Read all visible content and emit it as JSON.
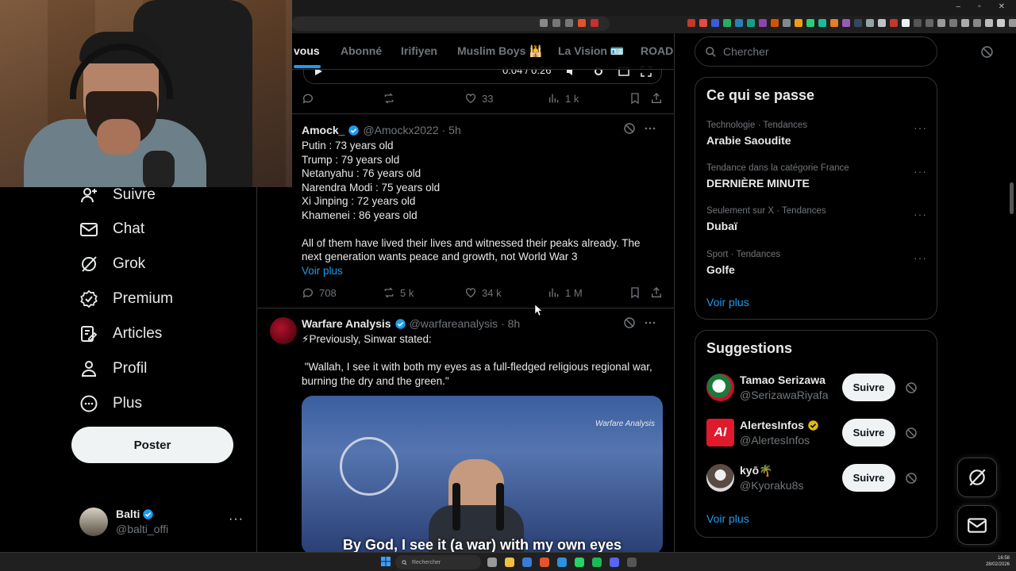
{
  "window": {
    "minimize": "–",
    "maximize": "▫",
    "close": "✕"
  },
  "nav": {
    "items": [
      {
        "label": "Suivre",
        "icon": "follow-icon"
      },
      {
        "label": "Chat",
        "icon": "mail-icon"
      },
      {
        "label": "Grok",
        "icon": "grok-icon"
      },
      {
        "label": "Premium",
        "icon": "premium-icon"
      },
      {
        "label": "Articles",
        "icon": "articles-icon"
      },
      {
        "label": "Profil",
        "icon": "profile-icon"
      },
      {
        "label": "Plus",
        "icon": "more-icon"
      }
    ],
    "post_button": "Poster",
    "profile": {
      "name": "Balti",
      "handle": "@balti_offi",
      "more": "···"
    }
  },
  "tabs": [
    "vous",
    "Abonné",
    "Irifiyen",
    "Muslim Boys 🕌",
    "La Vision 🪪",
    "ROAD"
  ],
  "video_time": "0:04 / 0:26",
  "tweets": [
    {
      "id": "top",
      "stats": {
        "replies": "",
        "reposts": "",
        "likes": "33",
        "views": "1 k"
      }
    },
    {
      "id": "amock",
      "name": "Amock_",
      "handle": "@Amockx2022",
      "time": "· 5h",
      "lines": [
        "Putin : 73 years old",
        "Trump : 79 years old",
        "Netanyahu : 76 years old",
        "Narendra Modi : 75 years old",
        "Xi Jinping : 72 years old",
        "Khamenei : 86 years old",
        "All of them have lived their lives and witnessed their peaks already. The",
        "next generation wants peace and growth, not World War 3"
      ],
      "voir_plus": "Voir plus",
      "stats": {
        "replies": "708",
        "reposts": "5 k",
        "likes": "34 k",
        "views": "1 M"
      }
    },
    {
      "id": "warfare",
      "name": "Warfare Analysis",
      "handle": "@warfareanalysis",
      "time": "· 8h",
      "lines": [
        "⚡Previously, Sinwar stated:",
        " \"Wallah, I see it with both my eyes as a full-fledged religious regional war,",
        "burning the dry and the green.\""
      ],
      "media": {
        "watermark": "Warfare Analysis",
        "caption": "By God, I see it (a war) with my own eyes"
      }
    }
  ],
  "search": {
    "placeholder": "Chercher"
  },
  "trends": {
    "title": "Ce qui se passe",
    "items": [
      {
        "meta": "Technologie · Tendances",
        "name": "Arabie Saoudite"
      },
      {
        "meta": "Tendance dans la catégorie France",
        "name": "DERNIÈRE MINUTE"
      },
      {
        "meta": "Seulement sur X · Tendances",
        "name": "Dubaï"
      },
      {
        "meta": "Sport · Tendances",
        "name": "Golfe"
      }
    ],
    "voir_plus": "Voir plus",
    "dots": "···"
  },
  "suggestions": {
    "title": "Suggestions",
    "items": [
      {
        "name": "Tamao Serizawa",
        "handle": "@SerizawaRiyafa",
        "button": "Suivre",
        "verified": false
      },
      {
        "name": "AlertesInfos",
        "handle": "@AlertesInfos",
        "button": "Suivre",
        "verified": true
      },
      {
        "name": "kyō🌴",
        "handle": "@Kyoraku8s",
        "button": "Suivre",
        "verified": false
      }
    ],
    "voir_plus": "Voir plus"
  },
  "taskbar": {
    "search": "Rechercher",
    "time": "16:58",
    "date": "28/02/2026"
  },
  "colors": {
    "accent": "#1d9bf0",
    "background": "#000000",
    "border": "#2f3336",
    "muted": "#71767b",
    "gold_check": "#e2b719"
  }
}
